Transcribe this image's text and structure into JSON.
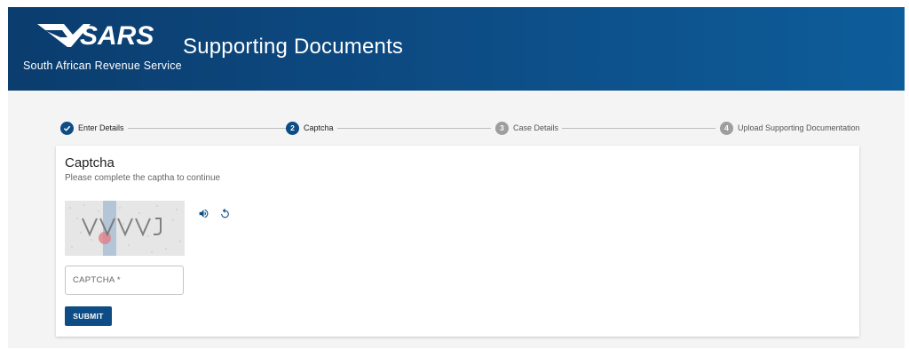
{
  "header": {
    "logo_text": "SARS",
    "org_name": "South African Revenue Service",
    "title": "Supporting Documents"
  },
  "stepper": {
    "steps": [
      {
        "number": "1",
        "label": "Enter Details",
        "state": "completed",
        "icon": "check-icon"
      },
      {
        "number": "2",
        "label": "Captcha",
        "state": "active"
      },
      {
        "number": "3",
        "label": "Case Details",
        "state": "inactive"
      },
      {
        "number": "4",
        "label": "Upload Supporting Documentation",
        "state": "inactive"
      }
    ]
  },
  "card": {
    "title": "Captcha",
    "subtitle": "Please complete the captha to continue",
    "audio_icon": "volume-icon",
    "refresh_icon": "refresh-icon",
    "captcha_placeholder": "CAPTCHA *",
    "captcha_value": "",
    "submit_label": "SUBMIT"
  },
  "colors": {
    "brand": "#0d4c85",
    "header_dark": "#0b3d6e",
    "inactive_step": "#9e9e9e",
    "page_bg": "#f4f4f4"
  }
}
